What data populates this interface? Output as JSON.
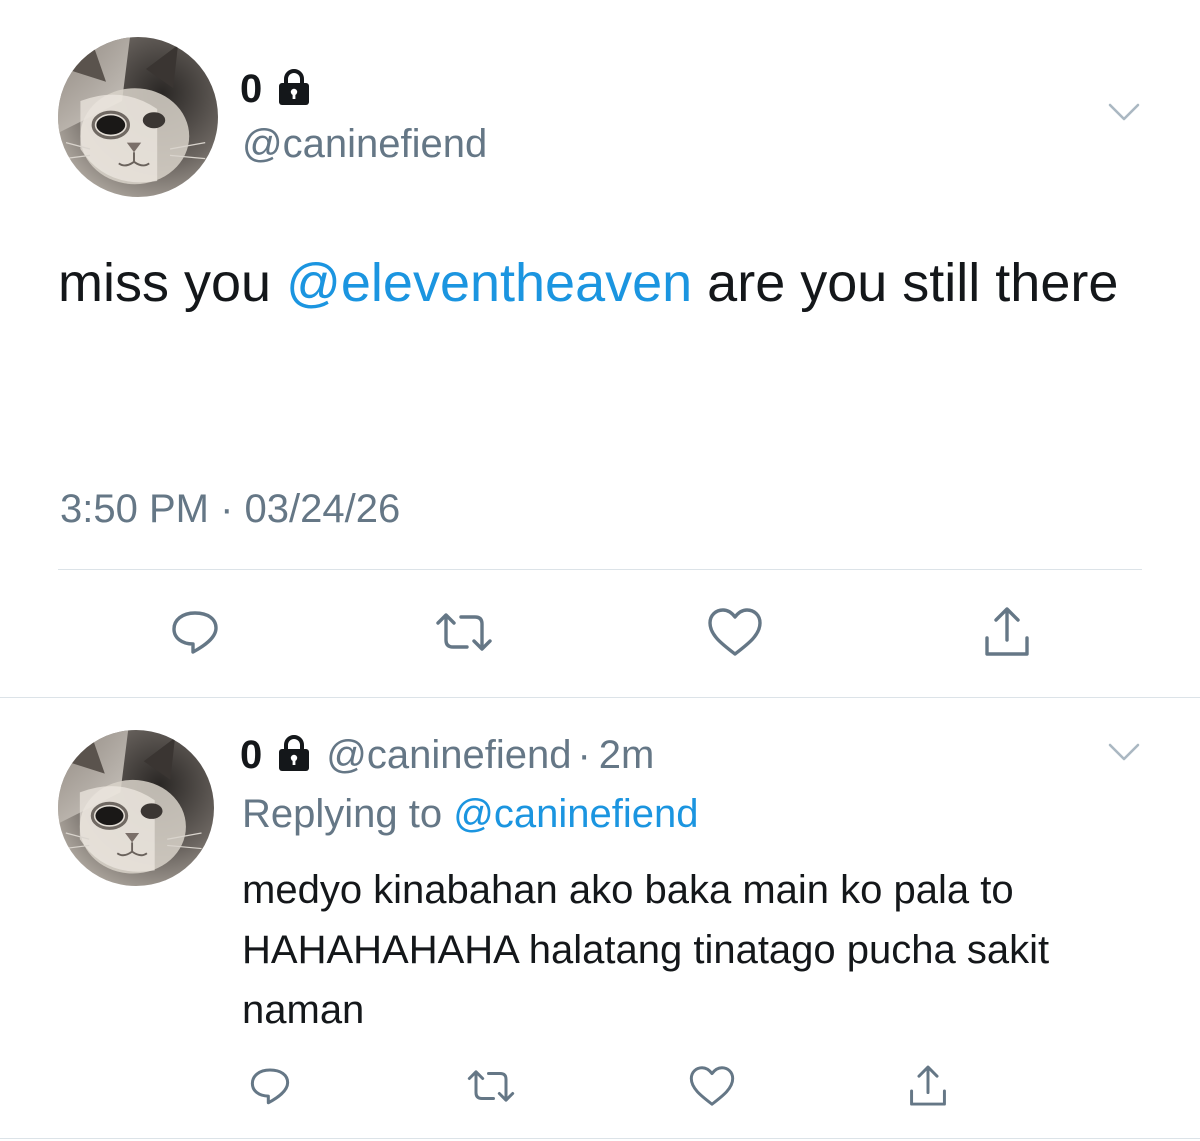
{
  "colors": {
    "text": "#14171a",
    "secondary": "#657786",
    "link": "#1b95e0",
    "divider": "#dce3e8"
  },
  "main_tweet": {
    "display_name": "0",
    "handle": "@caninefiend",
    "text_before": "miss you ",
    "mention": "@eleventheaven",
    "text_after": " are you still there",
    "timestamp": "3:50 PM · 03/24/26",
    "icons": [
      "lock-icon",
      "chevron-down-icon",
      "reply-icon",
      "retweet-icon",
      "like-icon",
      "share-icon"
    ]
  },
  "reply_tweet": {
    "display_name": "0",
    "handle": "@caninefiend",
    "separator": "·",
    "time_ago": "2m",
    "replying_label": "Replying to",
    "replying_handle": "@caninefiend",
    "text": "medyo kinabahan ako baka main ko pala to HAHAHAHAHA halatang tinatago pucha sakit naman",
    "icons": [
      "lock-icon",
      "chevron-down-icon",
      "reply-icon",
      "retweet-icon",
      "like-icon",
      "share-icon"
    ]
  }
}
